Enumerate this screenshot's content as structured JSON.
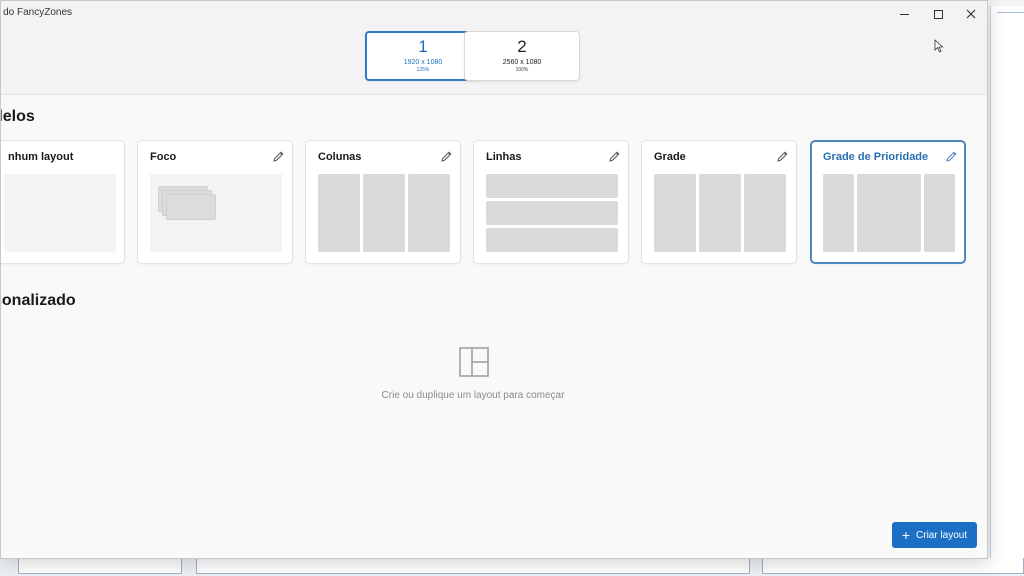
{
  "window": {
    "title": "r do FancyZones",
    "minimize_icon": "minimize-icon",
    "maximize_icon": "maximize-icon",
    "close_icon": "close-icon"
  },
  "monitors": [
    {
      "number": "1",
      "resolution": "1920 x 1080",
      "scale": "125%",
      "selected": true
    },
    {
      "number": "2",
      "resolution": "2560 x 1080",
      "scale": "100%",
      "selected": false
    }
  ],
  "templates": {
    "title": "delos",
    "cards": [
      {
        "name": "nhum layout",
        "selected": false
      },
      {
        "name": "Foco",
        "selected": false
      },
      {
        "name": "Colunas",
        "selected": false
      },
      {
        "name": "Linhas",
        "selected": false
      },
      {
        "name": "Grade",
        "selected": false
      },
      {
        "name": "Grade de Prioridade",
        "selected": true
      }
    ]
  },
  "custom": {
    "title": "sonalizado",
    "empty_message": "Crie ou duplique um layout para começar"
  },
  "actions": {
    "create_layout_label": "Criar layout"
  },
  "colors": {
    "accent": "#1b6fc4",
    "selected_border": "#4a87bd",
    "zone": "#d9d9d9"
  }
}
